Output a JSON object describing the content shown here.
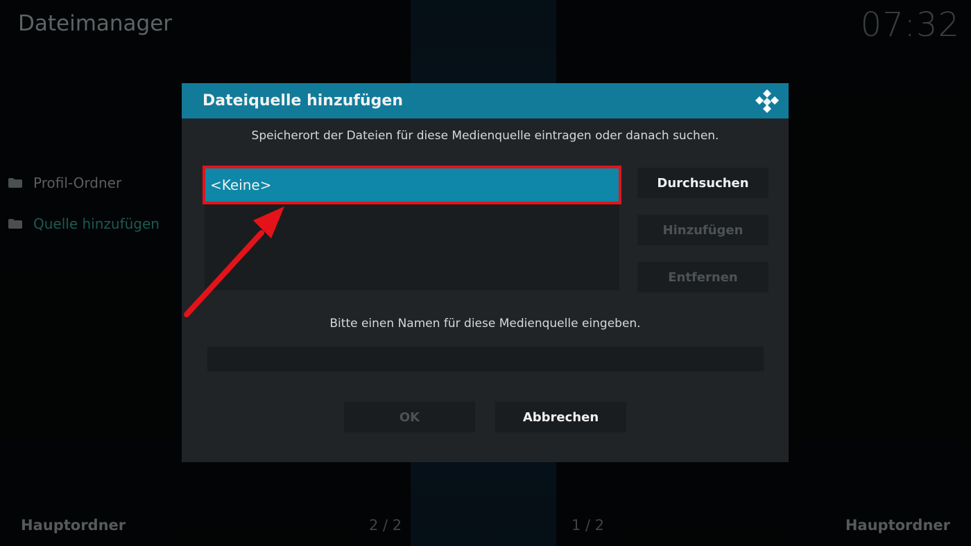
{
  "app": {
    "title": "Dateimanager",
    "clock": "07:32"
  },
  "sidebar": {
    "items": [
      {
        "label": "Profil-Ordner",
        "icon": "folder-icon",
        "active": false
      },
      {
        "label": "Quelle hinzufügen",
        "icon": "folder-icon",
        "active": true
      }
    ]
  },
  "footer": {
    "left_label": "Hauptordner",
    "left_page": "2 / 2",
    "right_page": "1 / 2",
    "right_label": "Hauptordner"
  },
  "dialog": {
    "title": "Dateiquelle hinzufügen",
    "logo_icon": "kodi-logo-icon",
    "subtitle": "Speicherort der Dateien für diese Medienquelle eintragen oder danach suchen.",
    "paths": [
      "<Keine>"
    ],
    "buttons": {
      "browse": "Durchsuchen",
      "add": "Hinzufügen",
      "remove": "Entfernen",
      "ok": "OK",
      "cancel": "Abbrechen"
    },
    "name_label": "Bitte einen Namen für diese Medienquelle eingeben.",
    "name_value": ""
  },
  "annotation": {
    "highlight_color": "#e4131a",
    "arrow_color": "#e4131a"
  },
  "colors": {
    "accent": "#127b9a",
    "selected_item": "#0e87a8"
  }
}
